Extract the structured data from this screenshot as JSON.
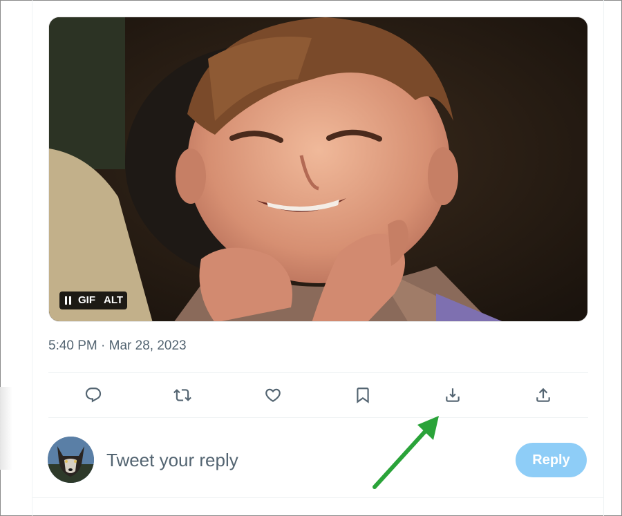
{
  "tweet": {
    "media": {
      "type": "gif",
      "description": "boy smiling with hands under chin",
      "badges": {
        "pause_icon": "pause-icon",
        "gif_label": "GIF",
        "alt_label": "ALT"
      }
    },
    "timestamp": "5:40 PM · Mar 28, 2023"
  },
  "actions": [
    {
      "name": "reply",
      "icon": "comment-icon"
    },
    {
      "name": "retweet",
      "icon": "retweet-icon"
    },
    {
      "name": "like",
      "icon": "heart-icon"
    },
    {
      "name": "bookmark",
      "icon": "bookmark-icon"
    },
    {
      "name": "download",
      "icon": "download-icon"
    },
    {
      "name": "share",
      "icon": "share-icon"
    }
  ],
  "reply_composer": {
    "placeholder": "Tweet your reply",
    "button_label": "Reply",
    "button_color": "#8ecdf7"
  },
  "annotation": {
    "arrow_color": "#2aa339",
    "points_to": "download"
  }
}
